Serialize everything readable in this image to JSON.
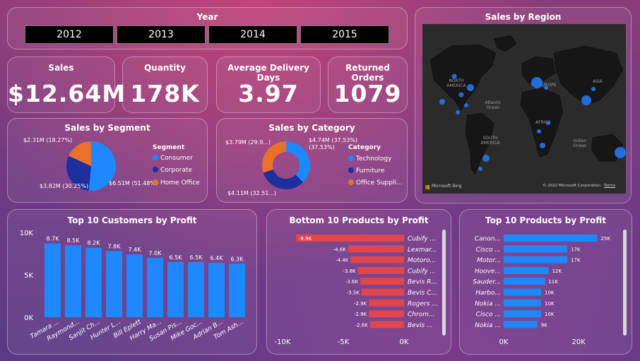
{
  "year_slicer": {
    "title": "Year",
    "years": [
      "2012",
      "2013",
      "2014",
      "2015"
    ]
  },
  "kpis": [
    {
      "label": "Sales",
      "value": "$12.64M"
    },
    {
      "label": "Quantity",
      "value": "178K"
    },
    {
      "label": "Average Delivery Days",
      "value": "3.97"
    },
    {
      "label": "Returned Orders",
      "value": "1079"
    }
  ],
  "map": {
    "title": "Sales by Region",
    "labels": [
      "NORTH AMERICA",
      "Atlantic Ocean",
      "EUROPE",
      "ASIA",
      "AFRICA",
      "SOUTH AMERICA",
      "Indian Ocean"
    ],
    "brand": "Microsoft Bing",
    "copyright": "© 2022 Microsoft Corporation",
    "terms": "Terms",
    "bubble_color": "#1f77f0"
  },
  "colors": {
    "blue": "#1e88ff",
    "navy": "#1f2e9e",
    "orange": "#e8702a",
    "red": "#e0464e"
  },
  "chart_data": [
    {
      "type": "pie",
      "title": "Sales by Segment",
      "legend_title": "Segment",
      "categories": [
        "Consumer",
        "Corporate",
        "Home Office"
      ],
      "values": [
        6.51,
        3.82,
        2.31
      ],
      "labels": [
        "$6.51M (51.48%)",
        "$3.82M (30.25%)",
        "$2.31M (18.27%)"
      ]
    },
    {
      "type": "pie",
      "title": "Sales by Category",
      "legend_title": "Category",
      "categories": [
        "Technology",
        "Furniture",
        "Office Suppli..."
      ],
      "values": [
        4.74,
        4.11,
        3.79
      ],
      "labels": [
        "$4.74M (37.53%)",
        "$4.11M (32.51...)",
        "$3.79M (29.9...)"
      ]
    },
    {
      "type": "bar",
      "title": "Top 10 Customers by Profit",
      "categories": [
        "Tamara ...",
        "Raymond...",
        "Sanjit Ch...",
        "Hunter L...",
        "Bill Eplett",
        "Harry Ma...",
        "Susan Pis...",
        "Mike Goc...",
        "Adrian B...",
        "Tom Ash..."
      ],
      "values": [
        8.7,
        8.5,
        8.2,
        7.8,
        7.4,
        7.0,
        6.5,
        6.5,
        6.4,
        6.3
      ],
      "data_labels": [
        "8.7K",
        "8.5K",
        "8.2K",
        "7.8K",
        "7.4K",
        "7.0K",
        "6.5K",
        "6.5K",
        "6.4K",
        "6.3K"
      ],
      "ylim": [
        0,
        10
      ],
      "yticks": [
        "0K",
        "5K",
        "10K"
      ]
    },
    {
      "type": "bar",
      "title": "Bottom 10 Products by Profit",
      "categories": [
        "Cubify ...",
        "Lexmar...",
        "Motoro...",
        "Cubify ...",
        "Bevis R...",
        "Bevis C...",
        "Rogers ...",
        "Chrom...",
        "Bevis ..."
      ],
      "values": [
        -8.9,
        -4.6,
        -4.4,
        -3.8,
        -3.6,
        -3.5,
        -2.9,
        -2.9,
        -2.8
      ],
      "data_labels": [
        "-8.9K",
        "-4.6K",
        "-4.4K",
        "-3.8K",
        "-3.6K",
        "-3.5K",
        "-2.9K",
        "-2.9K",
        "-2.8K"
      ],
      "xlim": [
        -10,
        0
      ],
      "xticks": [
        "-10K",
        "-5K",
        "0K"
      ]
    },
    {
      "type": "bar",
      "title": "Top 10 Products by Profit",
      "categories": [
        "Canon...",
        "Cisco ...",
        "Motor...",
        "Hoove...",
        "Sauder...",
        "Harbo...",
        "Nokia ...",
        "Cisco ...",
        "Nokia ..."
      ],
      "values": [
        25,
        17,
        17,
        12,
        11,
        10,
        10,
        10,
        9
      ],
      "data_labels": [
        "25K",
        "17K",
        "17K",
        "12K",
        "11K",
        "10K",
        "10K",
        "10K",
        "9K"
      ],
      "xlim": [
        0,
        30
      ],
      "xticks": [
        "0K",
        "20K"
      ]
    }
  ]
}
